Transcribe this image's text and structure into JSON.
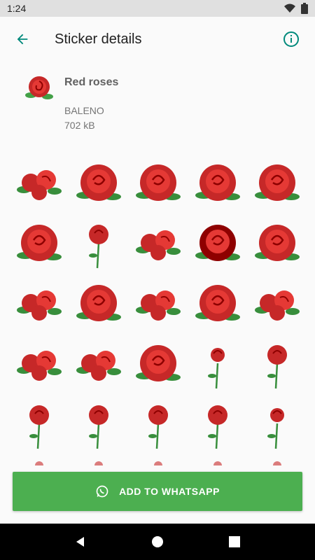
{
  "status_bar": {
    "time": "1:24"
  },
  "app_bar": {
    "title": "Sticker details",
    "back_icon": "arrow-back-icon",
    "info_icon": "info-icon"
  },
  "pack": {
    "name": "Red roses",
    "publisher": "BALENO",
    "size": "702 kB"
  },
  "stickers": [
    {
      "name": "rose-bouquet"
    },
    {
      "name": "rose-with-leaves"
    },
    {
      "name": "rose-on-branch"
    },
    {
      "name": "rose-bloom"
    },
    {
      "name": "rose-bloom"
    },
    {
      "name": "rose-with-leaves"
    },
    {
      "name": "rose-long-stem"
    },
    {
      "name": "rose-cluster"
    },
    {
      "name": "rose-bloom-dark"
    },
    {
      "name": "rose-bloom"
    },
    {
      "name": "rose-cluster"
    },
    {
      "name": "rose-single"
    },
    {
      "name": "rose-cluster"
    },
    {
      "name": "rose-with-leaves"
    },
    {
      "name": "rose-cluster"
    },
    {
      "name": "rose-garland"
    },
    {
      "name": "rose-garland"
    },
    {
      "name": "rose-with-leaves"
    },
    {
      "name": "rose-bud-stem"
    },
    {
      "name": "rose-long-stem"
    },
    {
      "name": "rose-long-stem"
    },
    {
      "name": "rose-stem-diagonal"
    },
    {
      "name": "rose-stem-diagonal"
    },
    {
      "name": "rose-long-stem"
    },
    {
      "name": "rose-bud-stem"
    },
    {
      "name": "rose-partial"
    },
    {
      "name": "rose-partial"
    },
    {
      "name": "rose-partial"
    },
    {
      "name": "rose-partial"
    },
    {
      "name": "rose-partial"
    }
  ],
  "add_button": {
    "label": "ADD TO WHATSAPP",
    "icon": "whatsapp-icon"
  },
  "colors": {
    "accent": "#00897b",
    "button": "#4caf50",
    "rose": "#d32f2f",
    "leaf": "#388e3c"
  }
}
